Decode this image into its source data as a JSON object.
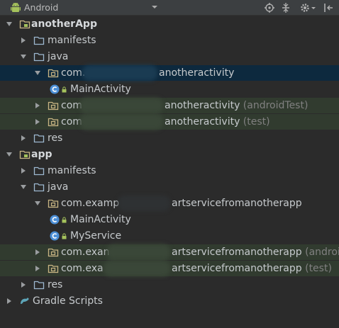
{
  "toolbar": {
    "view_label": "Android",
    "icons": [
      "android-icon",
      "chevron-down-icon",
      "locate-icon",
      "collapse-all-icon",
      "settings-icon",
      "hide-icon"
    ],
    "accent": "#a5c25c"
  },
  "tree": {
    "nodes": [
      {
        "label": "anotherApp",
        "type": "module",
        "expanded": true
      },
      {
        "label": "manifests",
        "type": "folder",
        "expanded": false
      },
      {
        "label": "java",
        "type": "folder",
        "expanded": true
      },
      {
        "label_start": "com.",
        "label_end": "anotheractivity",
        "type": "package",
        "expanded": true,
        "selected": true
      },
      {
        "label": "MainActivity",
        "type": "class"
      },
      {
        "label_start": "com",
        "label_end": "anotheractivity",
        "suffix": "(androidTest)",
        "type": "package",
        "expanded": false
      },
      {
        "label_start": "com",
        "label_end": "anotheractivity",
        "suffix": "(test)",
        "type": "package",
        "expanded": false
      },
      {
        "label": "res",
        "type": "folder",
        "expanded": false
      },
      {
        "label": "app",
        "type": "module",
        "expanded": true
      },
      {
        "label": "manifests",
        "type": "folder",
        "expanded": false
      },
      {
        "label": "java",
        "type": "folder",
        "expanded": true
      },
      {
        "label_start": "com.examp",
        "label_end": "artservicefromanotherapp",
        "type": "package",
        "expanded": true
      },
      {
        "label": "MainActivity",
        "type": "class"
      },
      {
        "label": "MyService",
        "type": "class"
      },
      {
        "label_start": "com.exan",
        "label_end": "artservicefromanotherapp",
        "suffix": "(androic",
        "type": "package",
        "expanded": false
      },
      {
        "label_start": "com.exa",
        "label_end": "artservicefromanotherapp",
        "suffix": "(test)",
        "type": "package",
        "expanded": false
      },
      {
        "label": "res",
        "type": "folder",
        "expanded": false
      },
      {
        "label": "Gradle Scripts",
        "type": "gradle",
        "expanded": false
      }
    ]
  }
}
